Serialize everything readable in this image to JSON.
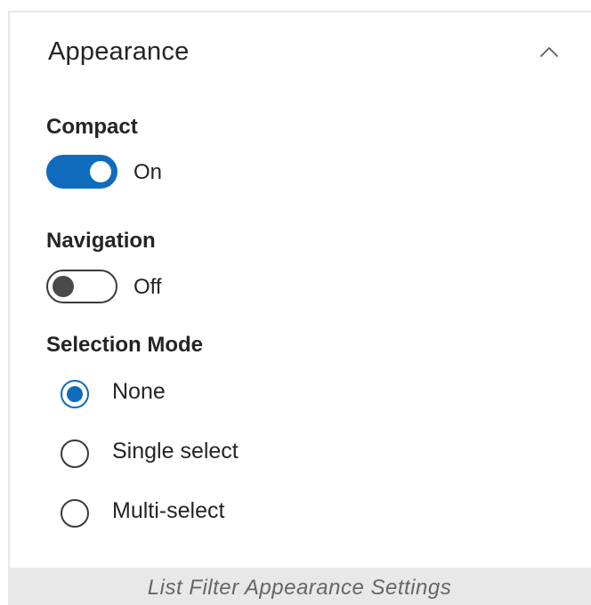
{
  "panel": {
    "title": "Appearance",
    "collapse_icon": "chevron-up-icon"
  },
  "compact": {
    "label": "Compact",
    "state": true,
    "state_text": "On",
    "accent_color": "#0f6cbd"
  },
  "navigation": {
    "label": "Navigation",
    "state": false,
    "state_text": "Off"
  },
  "selection_mode": {
    "label": "Selection Mode",
    "selected": "None",
    "options": [
      {
        "label": "None",
        "checked": true
      },
      {
        "label": "Single select",
        "checked": false
      },
      {
        "label": "Multi-select",
        "checked": false
      }
    ]
  },
  "caption": {
    "text": "List Filter Appearance Settings"
  }
}
